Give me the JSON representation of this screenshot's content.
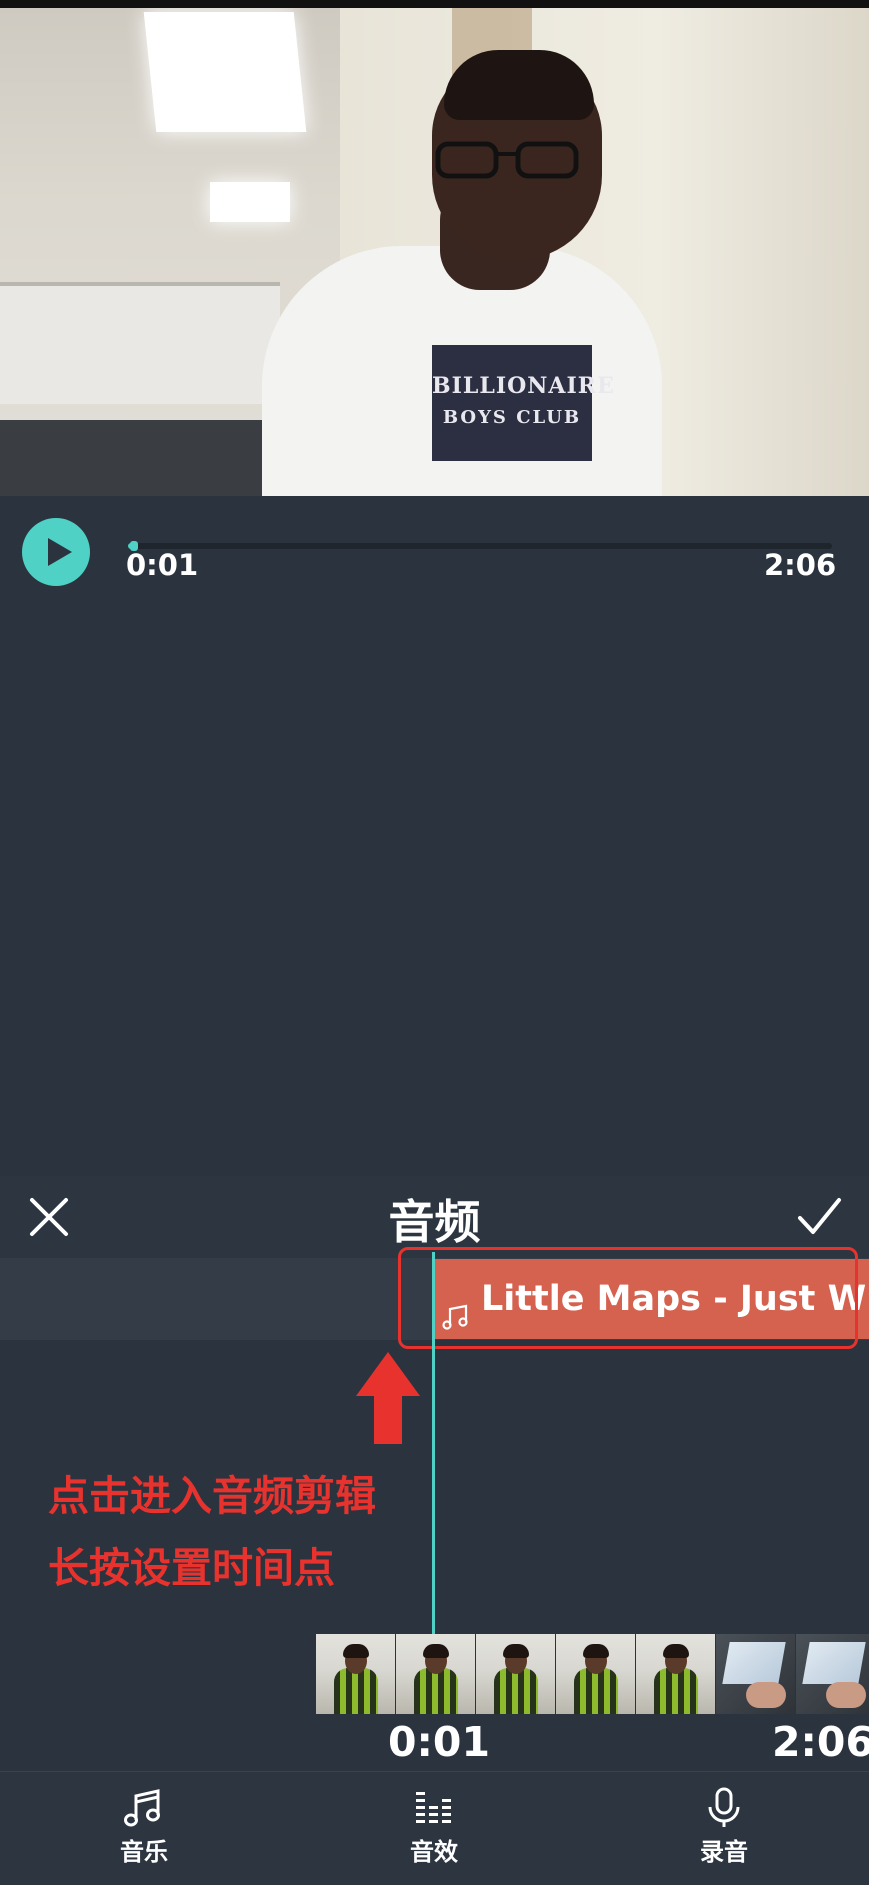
{
  "player": {
    "current_time": "0:01",
    "total_time": "2:06",
    "progress": 0.008
  },
  "video": {
    "shirt_text_line1": "BILLIONAIRE",
    "shirt_text_line2": "BOYS CLUB"
  },
  "panel": {
    "title": "音频"
  },
  "audio_clip": {
    "label": "Little Maps - Just Wit"
  },
  "annotation": {
    "line1": "点击进入音频剪辑",
    "line2": "长按设置时间点",
    "color": "#e8322e"
  },
  "timeline": {
    "start_time": "0:01",
    "end_time": "2:06"
  },
  "bottom_nav": {
    "items": [
      {
        "label": "音乐",
        "icon": "music-note-icon"
      },
      {
        "label": "音效",
        "icon": "equalizer-icon"
      },
      {
        "label": "录音",
        "icon": "microphone-icon"
      }
    ]
  },
  "colors": {
    "accent": "#4fd1c5",
    "background": "#2b343e",
    "clip": "#d5614f"
  }
}
